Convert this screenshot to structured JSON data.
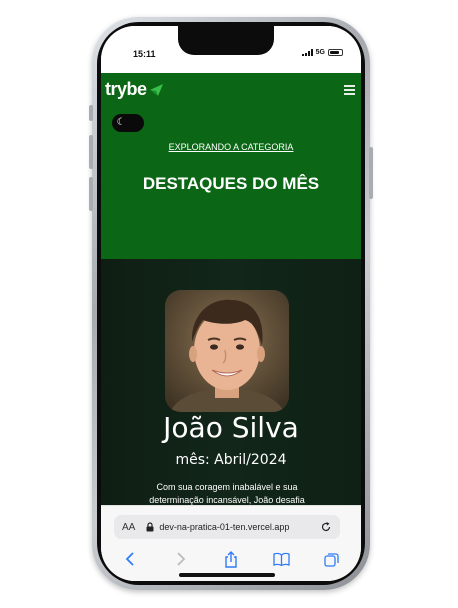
{
  "status": {
    "time": "15:11",
    "network": "5G"
  },
  "header": {
    "logo_text": "trybe",
    "menu_icon": "hamburger-menu-icon"
  },
  "theme_toggle": {
    "icon": "moon-icon"
  },
  "hero": {
    "category_link": "EXPLORANDO A CATEGORIA",
    "title": "DESTAQUES DO MÊS"
  },
  "feature": {
    "name": "João Silva",
    "month": "mês: Abril/2024",
    "description": "Com sua coragem inabalável e sua determinação incansável, João desafia os"
  },
  "browser": {
    "aa_label": "AA",
    "url": "dev-na-pratica-01-ten.vercel.app"
  },
  "colors": {
    "brand_green": "#0b6716",
    "logo_arrow": "#38c14a",
    "safari_blue": "#2f7cf6"
  }
}
